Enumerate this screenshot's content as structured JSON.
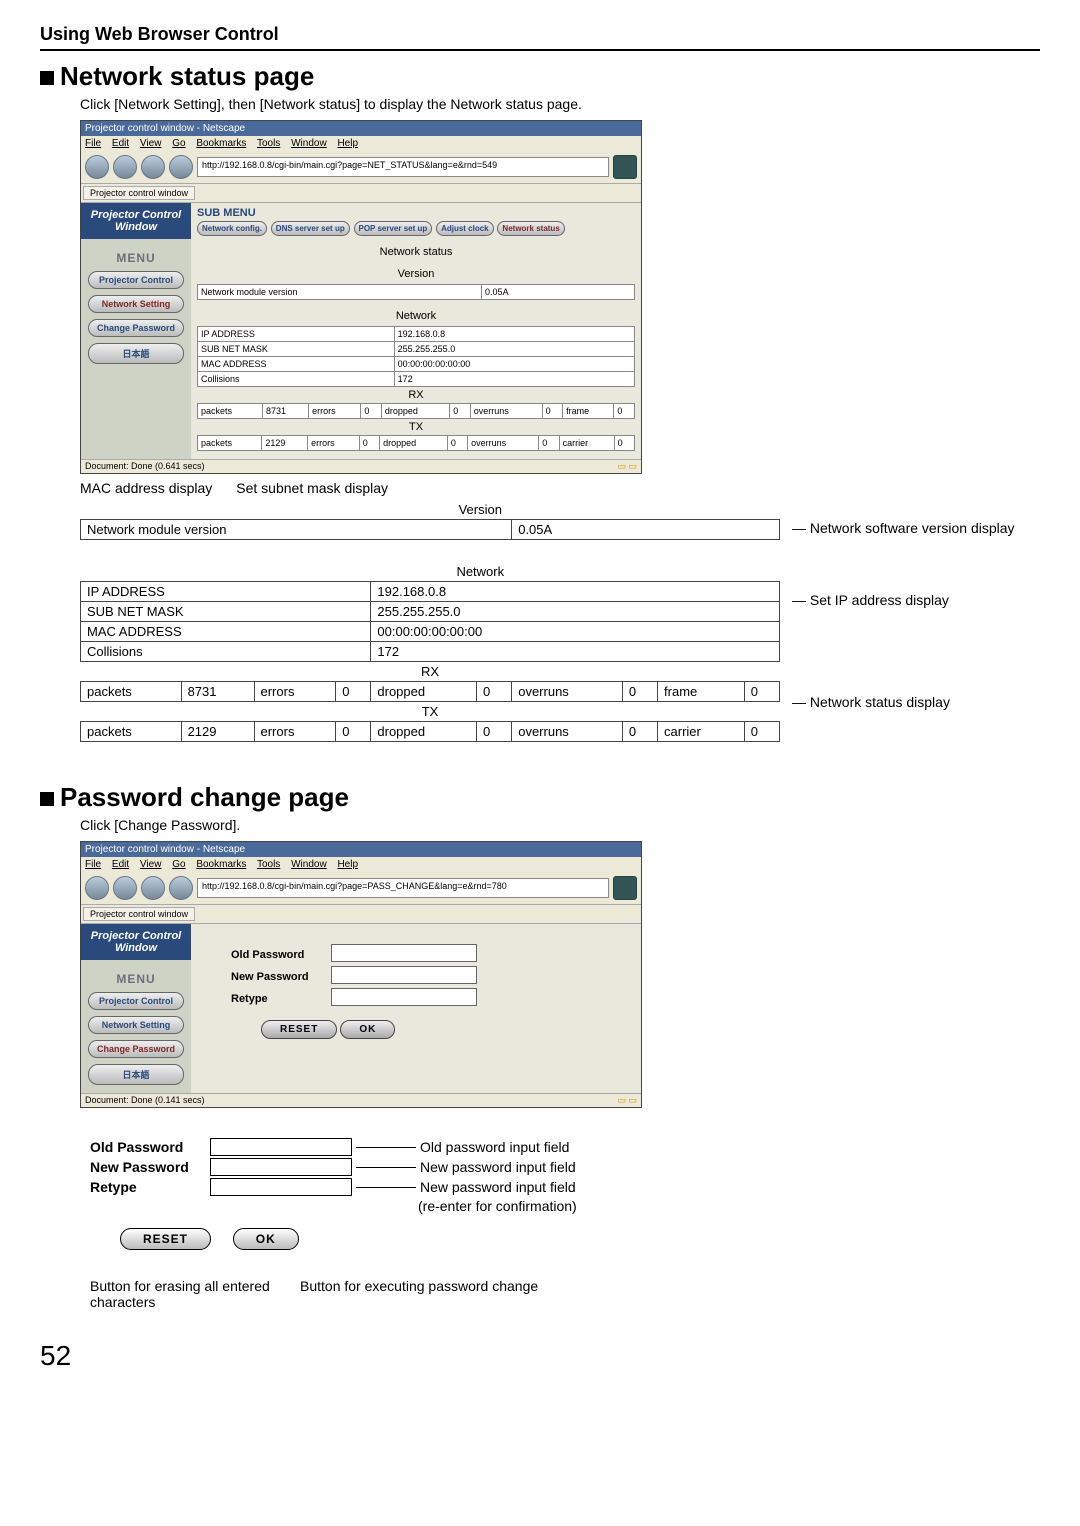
{
  "header": "Using Web Browser Control",
  "section1": {
    "title": "Network status page",
    "intro": "Click [Network Setting], then [Network status] to display the Network status page.",
    "browser_title": "Projector control window - Netscape",
    "menubar": [
      "File",
      "Edit",
      "View",
      "Go",
      "Bookmarks",
      "Tools",
      "Window",
      "Help"
    ],
    "url": "http://192.168.0.8/cgi-bin/main.cgi?page=NET_STATUS&lang=e&rnd=549",
    "tab": "Projector control window",
    "sidebar_title": "Projector Control Window",
    "menu_label": "MENU",
    "sidebar_items": [
      "Projector Control",
      "Network Setting",
      "Change Password",
      "日本語"
    ],
    "submenu_label": "SUB MENU",
    "subtabs": [
      "Network config.",
      "DNS server set up",
      "POP server set up",
      "Adjust clock",
      "Network status"
    ],
    "panel_headers": {
      "status": "Network status",
      "version": "Version",
      "network": "Network",
      "rx": "RX",
      "tx": "TX"
    },
    "version": {
      "label": "Network module version",
      "value": "0.05A"
    },
    "network": {
      "ip_label": "IP ADDRESS",
      "ip": "192.168.0.8",
      "sub_label": "SUB NET MASK",
      "sub": "255.255.255.0",
      "mac_label": "MAC ADDRESS",
      "mac": "00:00:00:00:00:00",
      "col_label": "Collisions",
      "col": "172"
    },
    "rx": {
      "packets_l": "packets",
      "packets": "8731",
      "errors_l": "errors",
      "errors": "0",
      "dropped_l": "dropped",
      "dropped": "0",
      "overruns_l": "overruns",
      "overruns": "0",
      "frame_l": "frame",
      "frame": "0"
    },
    "tx": {
      "packets_l": "packets",
      "packets": "2129",
      "errors_l": "errors",
      "errors": "0",
      "dropped_l": "dropped",
      "dropped": "0",
      "overruns_l": "overruns",
      "overruns": "0",
      "carrier_l": "carrier",
      "carrier": "0"
    },
    "status_left": "Document: Done (0.641 secs)",
    "callout_mac": "MAC address display",
    "callout_subnet": "Set subnet mask display",
    "annot_version": "Network software version display",
    "annot_ip": "Set IP address display",
    "annot_status": "Network status display"
  },
  "section2": {
    "title": "Password change page",
    "intro": "Click [Change Password].",
    "browser_title": "Projector control window - Netscape",
    "url": "http://192.168.0.8/cgi-bin/main.cgi?page=PASS_CHANGE&lang=e&rnd=780",
    "form": {
      "old": "Old Password",
      "new": "New Password",
      "retype": "Retype",
      "reset": "RESET",
      "ok": "OK"
    },
    "status_left": "Document: Done (0.141 secs)",
    "diagram": {
      "old": "Old Password",
      "old_note": "Old password input field",
      "new": "New Password",
      "new_note": "New password input field",
      "retype": "Retype",
      "retype_note": "New password input field",
      "retype_note2": "(re-enter for confirmation)",
      "reset": "RESET",
      "ok": "OK",
      "reset_caption": "Button for erasing all entered characters",
      "ok_caption": "Button for executing password change"
    }
  },
  "page_number": "52"
}
